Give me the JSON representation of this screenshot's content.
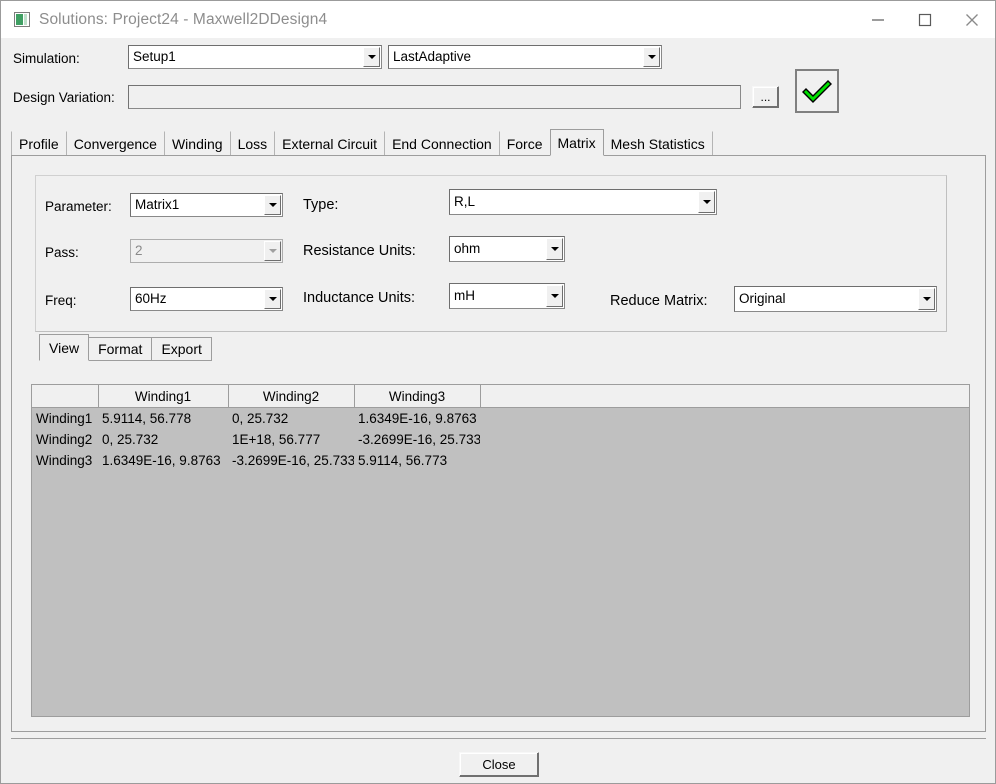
{
  "window": {
    "title": "Solutions: Project24 - Maxwell2DDesign4",
    "icon": "maxwell-solutions-icon",
    "controls": {
      "minimize": "minimize-icon",
      "maximize": "maximize-icon",
      "close": "close-icon"
    }
  },
  "form": {
    "simulation_label": "Simulation:",
    "setup_value": "Setup1",
    "solution_value": "LastAdaptive",
    "design_variation_label": "Design Variation:",
    "design_variation_value": "",
    "design_variation_placeholder": "",
    "browse_label": "...",
    "apply_icon": "green-check-icon"
  },
  "tabs": [
    {
      "label": "Profile",
      "active": false
    },
    {
      "label": "Convergence",
      "active": false
    },
    {
      "label": "Winding",
      "active": false
    },
    {
      "label": "Loss",
      "active": false
    },
    {
      "label": "External Circuit",
      "active": false
    },
    {
      "label": "End Connection",
      "active": false
    },
    {
      "label": "Force",
      "active": false
    },
    {
      "label": "Matrix",
      "active": true
    },
    {
      "label": "Mesh Statistics",
      "active": false
    }
  ],
  "params": {
    "parameter_label": "Parameter:",
    "parameter_value": "Matrix1",
    "pass_label": "Pass:",
    "pass_value": "2",
    "freq_label": "Freq:",
    "freq_value": "60Hz",
    "type_label": "Type:",
    "type_value": "R,L",
    "resistance_units_label": "Resistance Units:",
    "resistance_units_value": "ohm",
    "inductance_units_label": "Inductance Units:",
    "inductance_units_value": "mH",
    "reduce_matrix_label": "Reduce Matrix:",
    "reduce_matrix_value": "Original"
  },
  "subtabs": [
    {
      "label": "View",
      "active": true
    },
    {
      "label": "Format",
      "active": false
    },
    {
      "label": "Export",
      "active": false
    }
  ],
  "matrix_table": {
    "corner_header": "",
    "columns": [
      "Winding1",
      "Winding2",
      "Winding3"
    ],
    "rows": [
      {
        "label": "Winding1",
        "cells": [
          "5.9114, 56.778",
          "0, 25.732",
          "1.6349E-16, 9.8763"
        ]
      },
      {
        "label": "Winding2",
        "cells": [
          "0, 25.732",
          "1E+18, 56.777",
          "-3.2699E-16, 25.733"
        ]
      },
      {
        "label": "Winding3",
        "cells": [
          "1.6349E-16, 9.8763",
          "-3.2699E-16, 25.733",
          "5.9114, 56.773"
        ]
      }
    ]
  },
  "footer": {
    "close_label": "Close"
  },
  "colors": {
    "dialog_background": "#f0f0f0",
    "table_background": "#c0c0c0",
    "accent_check": "#00e000",
    "title_text": "#8d8d8d"
  }
}
